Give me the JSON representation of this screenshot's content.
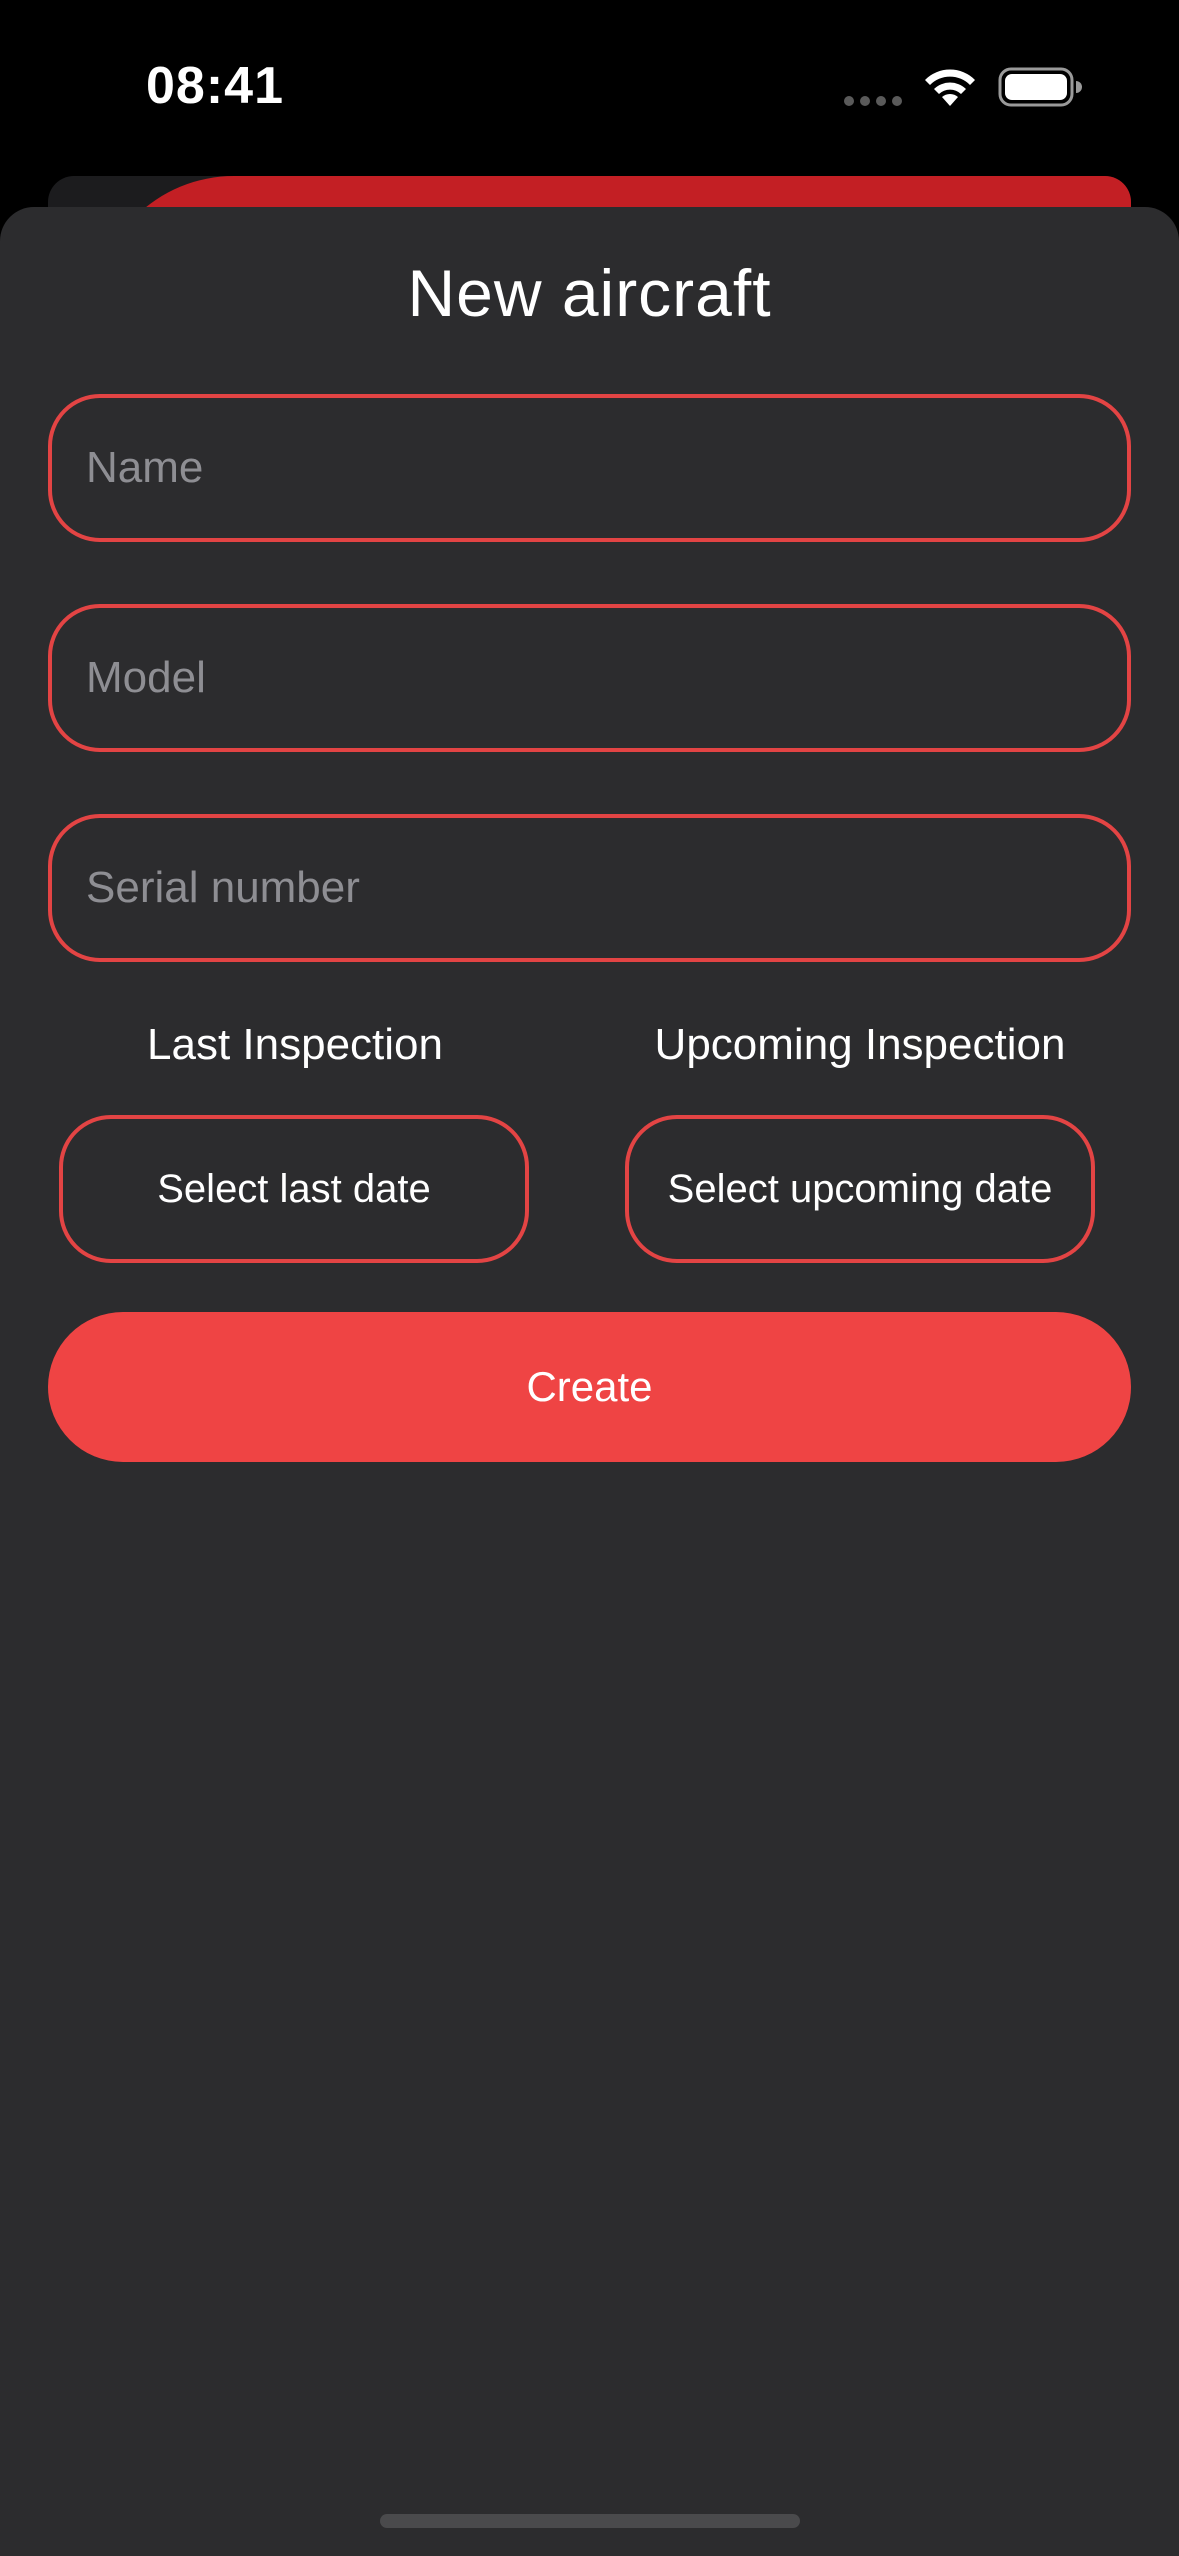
{
  "status_bar": {
    "time": "08:41",
    "icons": [
      "cellular-dots-icon",
      "wifi-icon",
      "battery-icon"
    ]
  },
  "sheet": {
    "title": "New aircraft"
  },
  "form": {
    "name_placeholder": "Name",
    "model_placeholder": "Model",
    "serial_placeholder": "Serial number",
    "last_inspection_label": "Last Inspection",
    "upcoming_inspection_label": "Upcoming Inspection",
    "last_date_button": "Select last date",
    "upcoming_date_button": "Select upcoming date",
    "create_button": "Create"
  },
  "colors": {
    "accent": "#ef4444",
    "field_border": "#e34444",
    "sheet_background": "#2c2c2e",
    "background_card_red": "#c31f24",
    "placeholder": "#8e8e93"
  }
}
